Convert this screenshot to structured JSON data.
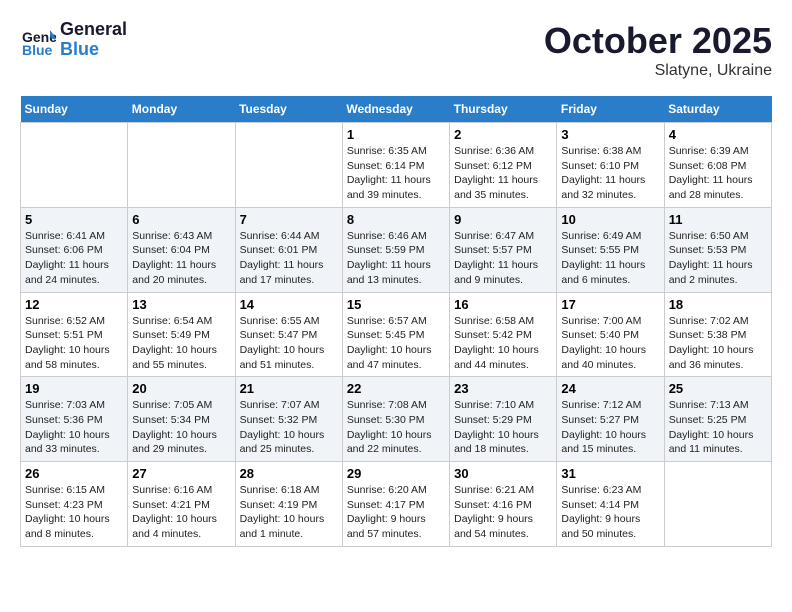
{
  "header": {
    "logo_line1": "General",
    "logo_line2": "Blue",
    "month": "October 2025",
    "location": "Slatyne, Ukraine"
  },
  "weekdays": [
    "Sunday",
    "Monday",
    "Tuesday",
    "Wednesday",
    "Thursday",
    "Friday",
    "Saturday"
  ],
  "weeks": [
    [
      {
        "day": "",
        "info": ""
      },
      {
        "day": "",
        "info": ""
      },
      {
        "day": "",
        "info": ""
      },
      {
        "day": "1",
        "info": "Sunrise: 6:35 AM\nSunset: 6:14 PM\nDaylight: 11 hours\nand 39 minutes."
      },
      {
        "day": "2",
        "info": "Sunrise: 6:36 AM\nSunset: 6:12 PM\nDaylight: 11 hours\nand 35 minutes."
      },
      {
        "day": "3",
        "info": "Sunrise: 6:38 AM\nSunset: 6:10 PM\nDaylight: 11 hours\nand 32 minutes."
      },
      {
        "day": "4",
        "info": "Sunrise: 6:39 AM\nSunset: 6:08 PM\nDaylight: 11 hours\nand 28 minutes."
      }
    ],
    [
      {
        "day": "5",
        "info": "Sunrise: 6:41 AM\nSunset: 6:06 PM\nDaylight: 11 hours\nand 24 minutes."
      },
      {
        "day": "6",
        "info": "Sunrise: 6:43 AM\nSunset: 6:04 PM\nDaylight: 11 hours\nand 20 minutes."
      },
      {
        "day": "7",
        "info": "Sunrise: 6:44 AM\nSunset: 6:01 PM\nDaylight: 11 hours\nand 17 minutes."
      },
      {
        "day": "8",
        "info": "Sunrise: 6:46 AM\nSunset: 5:59 PM\nDaylight: 11 hours\nand 13 minutes."
      },
      {
        "day": "9",
        "info": "Sunrise: 6:47 AM\nSunset: 5:57 PM\nDaylight: 11 hours\nand 9 minutes."
      },
      {
        "day": "10",
        "info": "Sunrise: 6:49 AM\nSunset: 5:55 PM\nDaylight: 11 hours\nand 6 minutes."
      },
      {
        "day": "11",
        "info": "Sunrise: 6:50 AM\nSunset: 5:53 PM\nDaylight: 11 hours\nand 2 minutes."
      }
    ],
    [
      {
        "day": "12",
        "info": "Sunrise: 6:52 AM\nSunset: 5:51 PM\nDaylight: 10 hours\nand 58 minutes."
      },
      {
        "day": "13",
        "info": "Sunrise: 6:54 AM\nSunset: 5:49 PM\nDaylight: 10 hours\nand 55 minutes."
      },
      {
        "day": "14",
        "info": "Sunrise: 6:55 AM\nSunset: 5:47 PM\nDaylight: 10 hours\nand 51 minutes."
      },
      {
        "day": "15",
        "info": "Sunrise: 6:57 AM\nSunset: 5:45 PM\nDaylight: 10 hours\nand 47 minutes."
      },
      {
        "day": "16",
        "info": "Sunrise: 6:58 AM\nSunset: 5:42 PM\nDaylight: 10 hours\nand 44 minutes."
      },
      {
        "day": "17",
        "info": "Sunrise: 7:00 AM\nSunset: 5:40 PM\nDaylight: 10 hours\nand 40 minutes."
      },
      {
        "day": "18",
        "info": "Sunrise: 7:02 AM\nSunset: 5:38 PM\nDaylight: 10 hours\nand 36 minutes."
      }
    ],
    [
      {
        "day": "19",
        "info": "Sunrise: 7:03 AM\nSunset: 5:36 PM\nDaylight: 10 hours\nand 33 minutes."
      },
      {
        "day": "20",
        "info": "Sunrise: 7:05 AM\nSunset: 5:34 PM\nDaylight: 10 hours\nand 29 minutes."
      },
      {
        "day": "21",
        "info": "Sunrise: 7:07 AM\nSunset: 5:32 PM\nDaylight: 10 hours\nand 25 minutes."
      },
      {
        "day": "22",
        "info": "Sunrise: 7:08 AM\nSunset: 5:30 PM\nDaylight: 10 hours\nand 22 minutes."
      },
      {
        "day": "23",
        "info": "Sunrise: 7:10 AM\nSunset: 5:29 PM\nDaylight: 10 hours\nand 18 minutes."
      },
      {
        "day": "24",
        "info": "Sunrise: 7:12 AM\nSunset: 5:27 PM\nDaylight: 10 hours\nand 15 minutes."
      },
      {
        "day": "25",
        "info": "Sunrise: 7:13 AM\nSunset: 5:25 PM\nDaylight: 10 hours\nand 11 minutes."
      }
    ],
    [
      {
        "day": "26",
        "info": "Sunrise: 6:15 AM\nSunset: 4:23 PM\nDaylight: 10 hours\nand 8 minutes."
      },
      {
        "day": "27",
        "info": "Sunrise: 6:16 AM\nSunset: 4:21 PM\nDaylight: 10 hours\nand 4 minutes."
      },
      {
        "day": "28",
        "info": "Sunrise: 6:18 AM\nSunset: 4:19 PM\nDaylight: 10 hours\nand 1 minute."
      },
      {
        "day": "29",
        "info": "Sunrise: 6:20 AM\nSunset: 4:17 PM\nDaylight: 9 hours\nand 57 minutes."
      },
      {
        "day": "30",
        "info": "Sunrise: 6:21 AM\nSunset: 4:16 PM\nDaylight: 9 hours\nand 54 minutes."
      },
      {
        "day": "31",
        "info": "Sunrise: 6:23 AM\nSunset: 4:14 PM\nDaylight: 9 hours\nand 50 minutes."
      },
      {
        "day": "",
        "info": ""
      }
    ]
  ]
}
